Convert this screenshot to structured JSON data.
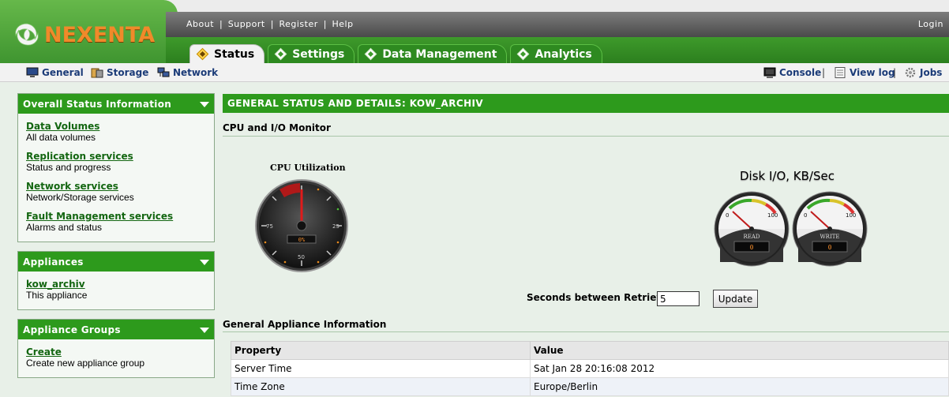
{
  "brand": {
    "name": "NEXENTA",
    "primary_color": "#2d9a1c",
    "accent_color": "#f08a2a"
  },
  "top_links": [
    "About",
    "Support",
    "Register",
    "Help"
  ],
  "login_label": "Login",
  "tabs": [
    {
      "label": "Status",
      "active": true
    },
    {
      "label": "Settings",
      "active": false
    },
    {
      "label": "Data Management",
      "active": false
    },
    {
      "label": "Analytics",
      "active": false
    }
  ],
  "subnav": {
    "left": [
      {
        "label": "General",
        "icon": "monitor-icon"
      },
      {
        "label": "Storage",
        "icon": "storage-icon"
      },
      {
        "label": "Network",
        "icon": "network-icon"
      }
    ],
    "right": [
      {
        "label": "Console",
        "icon": "console-icon"
      },
      {
        "label": "View log",
        "icon": "log-icon"
      },
      {
        "label": "Jobs",
        "icon": "gear-icon"
      }
    ]
  },
  "sidebar": {
    "overall": {
      "title": "Overall Status Information",
      "items": [
        {
          "link": "Data Volumes",
          "desc": "All data volumes"
        },
        {
          "link": "Replication services",
          "desc": "Status and progress"
        },
        {
          "link": "Network services",
          "desc": "Network/Storage services"
        },
        {
          "link": "Fault Management services",
          "desc": "Alarms and status"
        }
      ]
    },
    "appliances": {
      "title": "Appliances",
      "items": [
        {
          "link": "kow_archiv",
          "desc": "This appliance"
        }
      ]
    },
    "groups": {
      "title": "Appliance Groups",
      "items": [
        {
          "link": "Create",
          "desc": "Create new appliance group"
        }
      ]
    }
  },
  "main": {
    "header": "GENERAL STATUS AND DETAILS: KOW_ARCHIV",
    "monitor_title": "CPU and I/O Monitor",
    "cpu_gauge": {
      "title": "CPU Utilization",
      "value": "0%",
      "ticks": [
        "25",
        "50",
        "75"
      ]
    },
    "disk_io": {
      "title": "Disk I/O, KB/Sec",
      "read": {
        "label": "READ",
        "value": "0",
        "min": "0",
        "max": "100"
      },
      "write": {
        "label": "WRITE",
        "value": "0",
        "min": "0",
        "max": "100"
      }
    },
    "retrieve_label": "Seconds between Retrieves",
    "retrieve_value": "5",
    "update_label": "Update",
    "info_title": "General Appliance Information",
    "table": {
      "headers": [
        "Property",
        "Value"
      ],
      "rows": [
        [
          "Server Time",
          "Sat Jan 28 20:16:08 2012"
        ],
        [
          "Time Zone",
          "Europe/Berlin"
        ]
      ]
    }
  }
}
